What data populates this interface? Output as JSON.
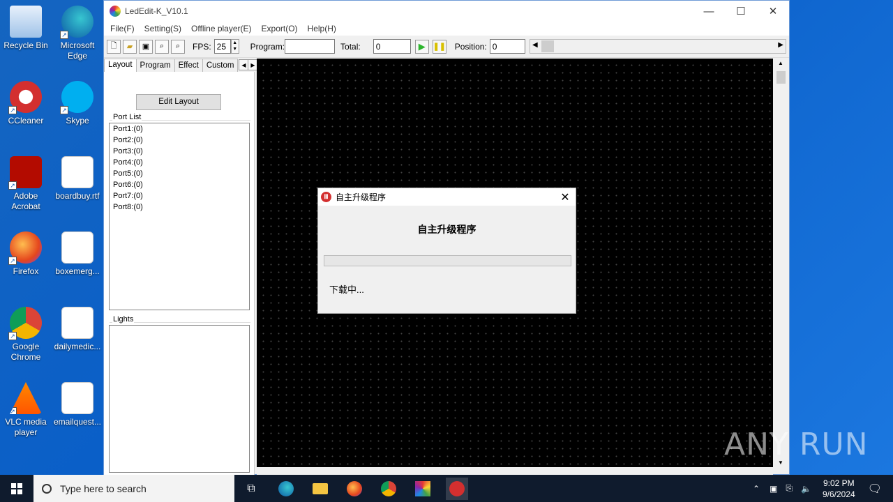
{
  "desktop": {
    "icons": [
      {
        "label": "Recycle Bin",
        "icon": "recycle-bin-icon"
      },
      {
        "label": "Microsoft Edge",
        "icon": "edge-icon"
      },
      {
        "label": "CCleaner",
        "icon": "ccleaner-icon"
      },
      {
        "label": "Skype",
        "icon": "skype-icon"
      },
      {
        "label": "Adobe Acrobat",
        "icon": "acrobat-icon"
      },
      {
        "label": "boardbuy.rtf",
        "icon": "word-doc-icon"
      },
      {
        "label": "Firefox",
        "icon": "firefox-icon"
      },
      {
        "label": "boxemerg...",
        "icon": "image-file-icon"
      },
      {
        "label": "Google Chrome",
        "icon": "chrome-icon"
      },
      {
        "label": "dailymedic...",
        "icon": "image-file-icon"
      },
      {
        "label": "VLC media player",
        "icon": "vlc-icon"
      },
      {
        "label": "emailquest...",
        "icon": "word-doc-icon"
      }
    ],
    "watermark": "ANY RUN"
  },
  "window": {
    "title": "LedEdit-K_V10.1",
    "controls": {
      "minimize": "—",
      "maximize": "☐",
      "close": "✕"
    },
    "menu": [
      "File(F)",
      "Setting(S)",
      "Offline player(E)",
      "Export(O)",
      "Help(H)"
    ]
  },
  "toolbar": {
    "fps_label": "FPS:",
    "fps_value": "25",
    "program_label": "Program:",
    "program_value": "",
    "total_label": "Total:",
    "total_value": "0",
    "position_label": "Position:",
    "position_value": "0"
  },
  "leftpanel": {
    "tabs": [
      "Layout",
      "Program",
      "Effect",
      "Custom"
    ],
    "edit_layout_label": "Edit Layout",
    "port_list_label": "Port List",
    "ports": [
      "Port1:(0)",
      "Port2:(0)",
      "Port3:(0)",
      "Port4:(0)",
      "Port5:(0)",
      "Port6:(0)",
      "Port7:(0)",
      "Port8:(0)"
    ],
    "lights_label": "Lights"
  },
  "dialog": {
    "title": "自主升级程序",
    "heading": "自主升级程序",
    "progress": 0,
    "status": "下载中..."
  },
  "taskbar": {
    "search_placeholder": "Type here to search",
    "time": "9:02 PM",
    "date": "9/6/2024"
  }
}
